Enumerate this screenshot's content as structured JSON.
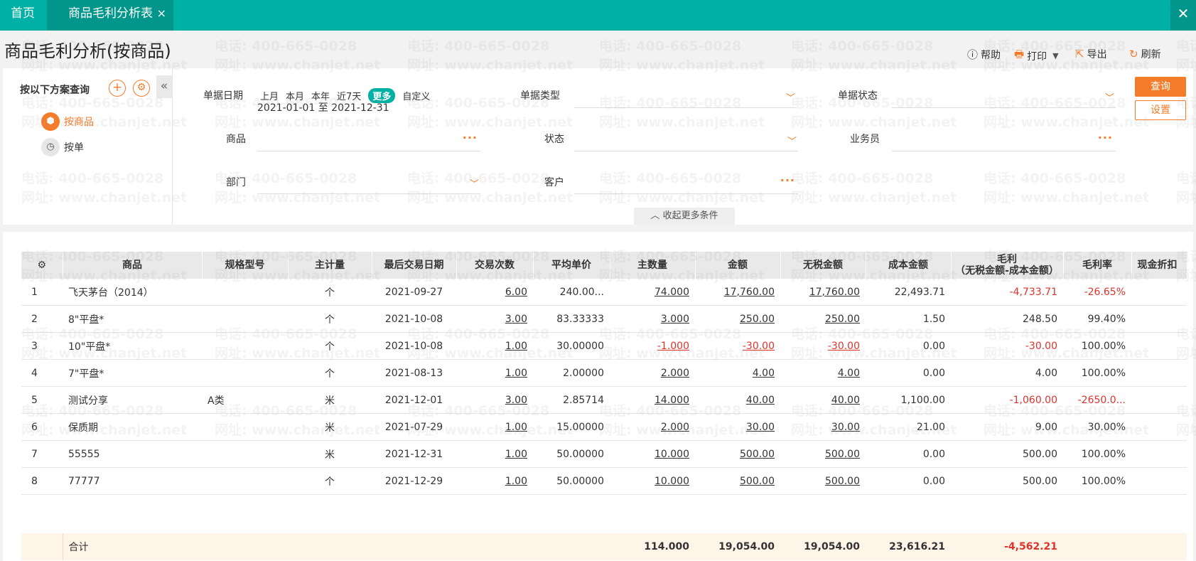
{
  "tabs": {
    "home": "首页",
    "active": "商品毛利分析表",
    "close": "×"
  },
  "window": {
    "close": "✕"
  },
  "title": "商品毛利分析(按商品)",
  "toolbar": {
    "help": "帮助",
    "print": "打印",
    "export": "导出",
    "refresh": "刷新"
  },
  "scheme": {
    "title": "按以下方案查询",
    "items": [
      {
        "label": "按商品",
        "active": true
      },
      {
        "label": "按单",
        "active": false
      }
    ]
  },
  "filters": {
    "date_label": "单据日期",
    "date_options": [
      "上月",
      "本月",
      "本年",
      "近7天",
      "更多",
      "自定义"
    ],
    "date_selected": "更多",
    "date_range": "2021-01-01 至 2021-12-31",
    "doc_type_label": "单据类型",
    "doc_status_label": "单据状态",
    "product_label": "商品",
    "status_label": "状态",
    "salesman_label": "业务员",
    "dept_label": "部门",
    "customer_label": "客户"
  },
  "buttons": {
    "query": "查询",
    "settings": "设置",
    "collapse_more": "收起更多条件"
  },
  "table": {
    "headers": [
      "商品",
      "规格型号",
      "主计量",
      "最后交易日期",
      "交易次数",
      "平均单价",
      "主数量",
      "金额",
      "无税金额",
      "成本金额",
      "毛利",
      "毛利率",
      "现金折扣"
    ],
    "header_sub_profit": "（无税金额-成本金额）",
    "rows": [
      {
        "no": "1",
        "name": "飞天茅台（2014）",
        "spec": "",
        "unit": "个",
        "date": "2021-09-27",
        "count": "6.00",
        "price": "240.00...",
        "qty": "74.000",
        "amount": "17,760.00",
        "notax": "17,760.00",
        "cost": "22,493.71",
        "profit": "-4,733.71",
        "rate": "-26.65%"
      },
      {
        "no": "2",
        "name": "8\"平盘*",
        "spec": "",
        "unit": "个",
        "date": "2021-10-08",
        "count": "3.00",
        "price": "83.33333",
        "qty": "3.000",
        "amount": "250.00",
        "notax": "250.00",
        "cost": "1.50",
        "profit": "248.50",
        "rate": "99.40%"
      },
      {
        "no": "3",
        "name": "10\"平盘*",
        "spec": "",
        "unit": "个",
        "date": "2021-10-08",
        "count": "1.00",
        "price": "30.00000",
        "qty": "-1.000",
        "amount": "-30.00",
        "notax": "-30.00",
        "cost": "0.00",
        "profit": "-30.00",
        "rate": "100.00%"
      },
      {
        "no": "4",
        "name": "7\"平盘*",
        "spec": "",
        "unit": "个",
        "date": "2021-08-13",
        "count": "1.00",
        "price": "2.00000",
        "qty": "2.000",
        "amount": "4.00",
        "notax": "4.00",
        "cost": "0.00",
        "profit": "4.00",
        "rate": "100.00%"
      },
      {
        "no": "5",
        "name": "测试分享",
        "spec": "A类",
        "unit": "米",
        "date": "2021-12-01",
        "count": "3.00",
        "price": "2.85714",
        "qty": "14.000",
        "amount": "40.00",
        "notax": "40.00",
        "cost": "1,100.00",
        "profit": "-1,060.00",
        "rate": "-2650.0..."
      },
      {
        "no": "6",
        "name": "保质期",
        "spec": "",
        "unit": "米",
        "date": "2021-07-29",
        "count": "1.00",
        "price": "15.00000",
        "qty": "2.000",
        "amount": "30.00",
        "notax": "30.00",
        "cost": "21.00",
        "profit": "9.00",
        "rate": "30.00%"
      },
      {
        "no": "7",
        "name": "55555",
        "spec": "",
        "unit": "米",
        "date": "2021-12-31",
        "count": "1.00",
        "price": "50.00000",
        "qty": "10.000",
        "amount": "500.00",
        "notax": "500.00",
        "cost": "0.00",
        "profit": "500.00",
        "rate": "100.00%"
      },
      {
        "no": "8",
        "name": "77777",
        "spec": "",
        "unit": "个",
        "date": "2021-12-29",
        "count": "1.00",
        "price": "50.00000",
        "qty": "10.000",
        "amount": "500.00",
        "notax": "500.00",
        "cost": "0.00",
        "profit": "500.00",
        "rate": "100.00%"
      }
    ],
    "total": {
      "label": "合计",
      "qty": "114.000",
      "amount": "19,054.00",
      "notax": "19,054.00",
      "cost": "23,616.21",
      "profit": "-4,562.21"
    }
  },
  "watermark": {
    "phone": "电话: 400-665-0028",
    "site": "网址: www.chanjet.net"
  },
  "colors": {
    "primary": "#00b0a5",
    "accent": "#f47b28",
    "negative": "#e0332c"
  }
}
